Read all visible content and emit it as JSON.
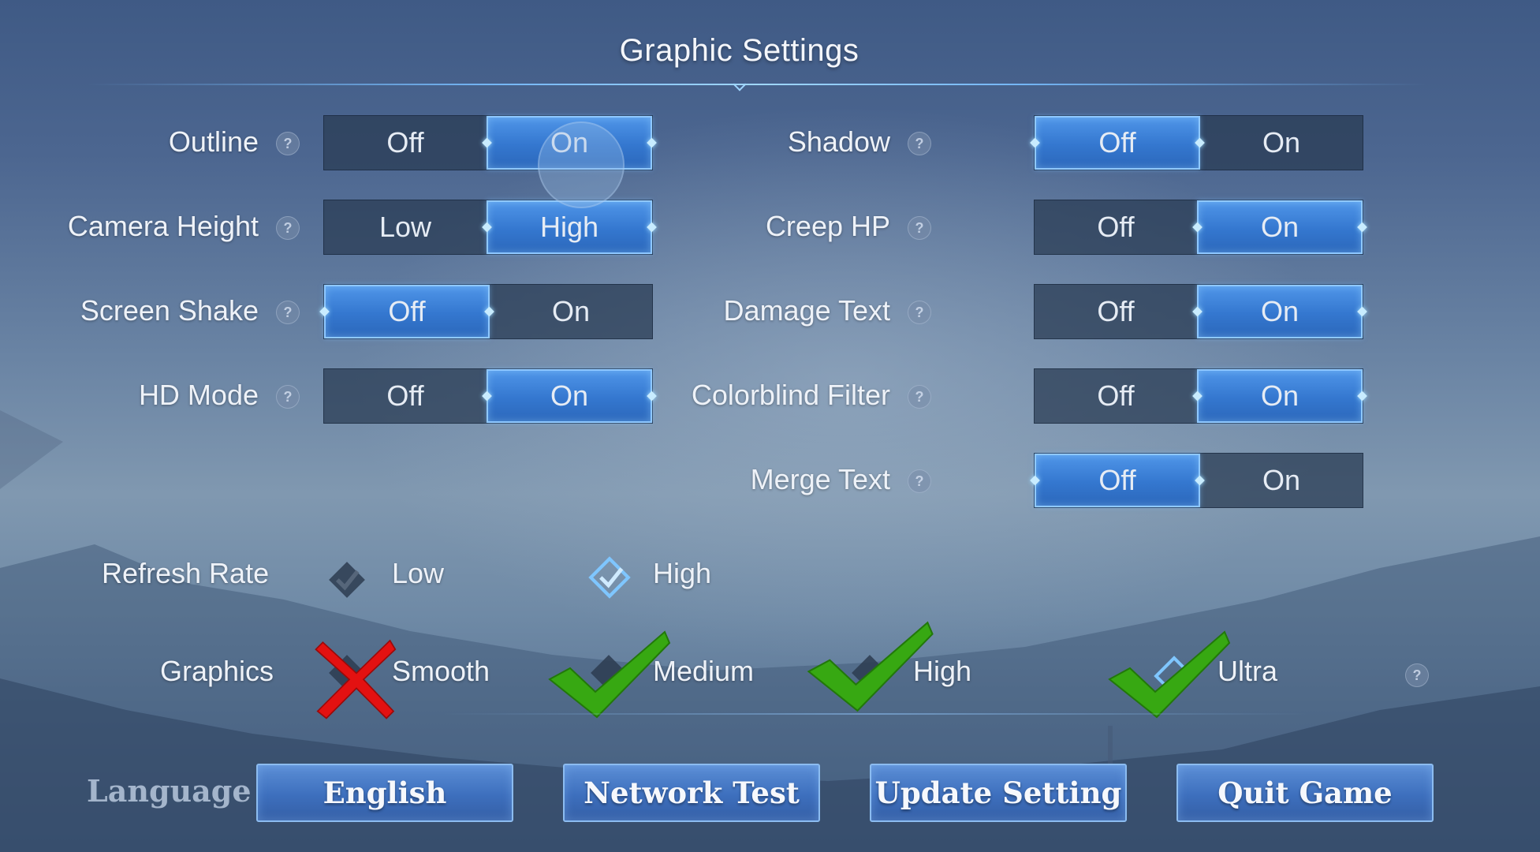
{
  "title": "Graphic Settings",
  "help_glyph": "?",
  "left_settings": [
    {
      "label": "Outline",
      "options": [
        "Off",
        "On"
      ],
      "selected": "On"
    },
    {
      "label": "Camera Height",
      "options": [
        "Low",
        "High"
      ],
      "selected": "High"
    },
    {
      "label": "Screen Shake",
      "options": [
        "Off",
        "On"
      ],
      "selected": "Off"
    },
    {
      "label": "HD Mode",
      "options": [
        "Off",
        "On"
      ],
      "selected": "On"
    }
  ],
  "right_settings": [
    {
      "label": "Shadow",
      "options": [
        "Off",
        "On"
      ],
      "selected": "Off"
    },
    {
      "label": "Creep HP",
      "options": [
        "Off",
        "On"
      ],
      "selected": "On"
    },
    {
      "label": "Damage Text",
      "options": [
        "Off",
        "On"
      ],
      "selected": "On"
    },
    {
      "label": "Colorblind Filter",
      "options": [
        "Off",
        "On"
      ],
      "selected": "On"
    },
    {
      "label": "Merge Text",
      "options": [
        "Off",
        "On"
      ],
      "selected": "Off"
    }
  ],
  "refresh_rate": {
    "label": "Refresh Rate",
    "options": [
      "Low",
      "High"
    ],
    "selected": "High"
  },
  "graphics": {
    "label": "Graphics",
    "options": [
      "Smooth",
      "Medium",
      "High",
      "Ultra"
    ],
    "selected": "Ultra",
    "annotations": {
      "Smooth": "red-x-mark",
      "Medium": "green-check-mark",
      "High": "green-check-mark",
      "Ultra": "green-check-mark"
    }
  },
  "footer": {
    "language_label": "Language",
    "language_button": "English",
    "network_test_button": "Network Test",
    "update_setting_button": "Update Setting",
    "quit_game_button": "Quit Game"
  },
  "colors": {
    "active_toggle": "#3a7fd6",
    "inactive_toggle": "#2b3e58",
    "accent_line": "#9fd6ff",
    "check_green": "#3aa514",
    "x_red": "#e01010"
  }
}
